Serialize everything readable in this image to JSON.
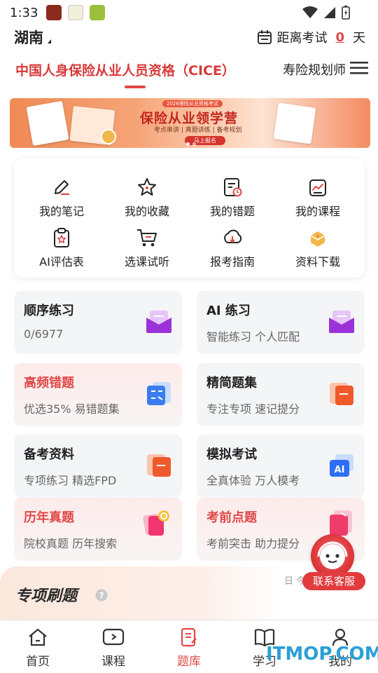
{
  "status_bar": {
    "time": "1:33"
  },
  "header": {
    "region": "湖南",
    "countdown_label": "距离考试",
    "countdown_days": "0",
    "countdown_unit": "天"
  },
  "category_tabs": {
    "active": "中国人身保险从业人员资格（CICE）",
    "second": "寿险规划师"
  },
  "banner": {
    "tag": "2026保险从业资格考试",
    "title": "保险从业领学营",
    "subtitle": "考点串讲 | 真题讲练 | 备考规划",
    "button": "马上报名"
  },
  "functions": [
    {
      "label": "我的笔记",
      "icon": "note-pen-icon"
    },
    {
      "label": "我的收藏",
      "icon": "star-icon"
    },
    {
      "label": "我的错题",
      "icon": "wrong-questions-icon"
    },
    {
      "label": "我的课程",
      "icon": "course-icon"
    },
    {
      "label": "AI评估表",
      "icon": "evaluation-clipboard-icon"
    },
    {
      "label": "选课试听",
      "icon": "cart-icon"
    },
    {
      "label": "报考指南",
      "icon": "download-guide-icon"
    },
    {
      "label": "资料下载",
      "icon": "materials-box-icon"
    }
  ],
  "practice": [
    {
      "title": "顺序练习",
      "subtitle": "0/6977",
      "icon": "purple-envelope-icon"
    },
    {
      "title": "AI 练习",
      "subtitle": "智能练习 个人匹配",
      "icon": "purple-envelope-icon"
    },
    {
      "title": "高频错题",
      "subtitle": "优选35% 易错题集",
      "icon": "calculator-icon"
    },
    {
      "title": "精简题集",
      "subtitle": "专注专项 速记提分",
      "icon": "orange-folder-icon"
    },
    {
      "title": "备考资料",
      "subtitle": "专项练习 精选FPD",
      "icon": "orange-folder-icon"
    },
    {
      "title": "模拟考试",
      "subtitle": "全真体验 万人模考",
      "icon": "ai-exam-icon"
    },
    {
      "title": "历年真题",
      "subtitle": "院校真题 历年搜索",
      "icon": "search-paper-icon"
    },
    {
      "title": "考前点题",
      "subtitle": "考前突击 助力提分",
      "icon": "pink-book-icon"
    }
  ],
  "special": {
    "title": "专项刷题",
    "peek": "日 今日"
  },
  "support": {
    "label": "联系客服"
  },
  "bottom_nav": [
    {
      "label": "首页",
      "icon": "home-icon"
    },
    {
      "label": "课程",
      "icon": "play-icon"
    },
    {
      "label": "题库",
      "icon": "question-bank-icon"
    },
    {
      "label": "学习",
      "icon": "book-icon"
    },
    {
      "label": "我的",
      "icon": "user-icon"
    }
  ],
  "watermark": "ITMOP.COM",
  "colors": {
    "accent": "#e04848",
    "card_bg": "#f4f5f7",
    "watermark": "#2a9fd6"
  }
}
